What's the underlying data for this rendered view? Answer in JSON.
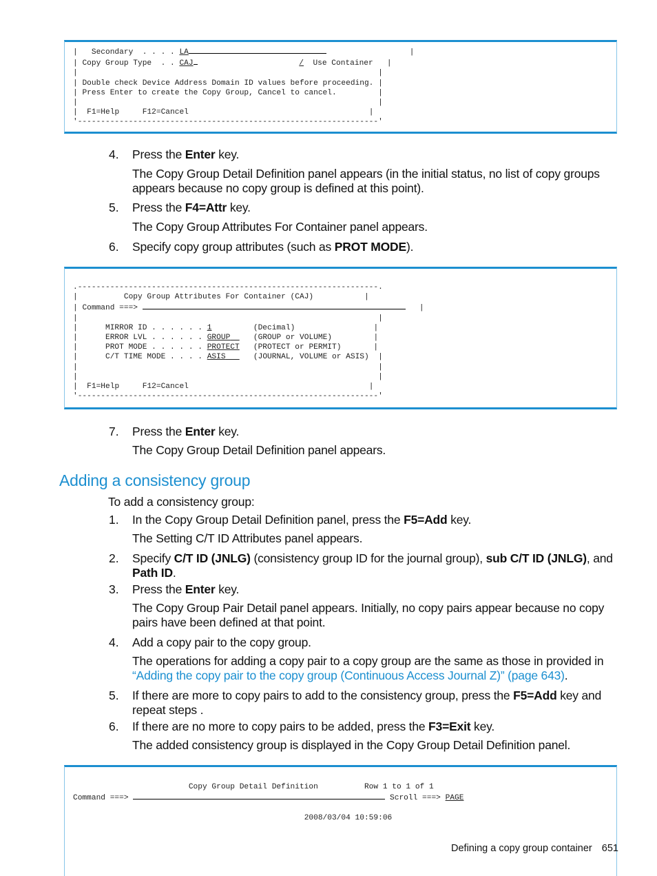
{
  "panel1": {
    "secondary_label": "Secondary  . . . .",
    "secondary_value": "LA",
    "type_label": "Copy Group Type  . .",
    "type_value": "CAJ",
    "use_container_mark": "/",
    "use_container_label": "Use Container",
    "message1": "Double check Device Address Domain ID values before proceeding.",
    "message2": "Press Enter to create the Copy Group, Cancel to cancel.",
    "f1": "F1=Help",
    "f12": "F12=Cancel"
  },
  "steps_a": [
    {
      "num": "4.",
      "pre": "Press the ",
      "key": "Enter",
      "post": " key.",
      "desc": "The Copy Group Detail Definition panel appears (in the initial status, no list of copy groups appears because no copy group is defined at this point)."
    },
    {
      "num": "5.",
      "pre": "Press the ",
      "key": "F4=Attr",
      "post": " key.",
      "desc": "The Copy Group Attributes For Container panel appears."
    },
    {
      "num": "6.",
      "pre": "Specify copy group attributes (such as ",
      "key": "PROT MODE",
      "post": ")."
    }
  ],
  "panel2": {
    "title": "Copy Group Attributes For Container (CAJ)",
    "command_label": "Command ===>",
    "fields": [
      {
        "label": "MIRROR ID . . . . . .",
        "value": "1",
        "hint": "(Decimal)"
      },
      {
        "label": "ERROR LVL . . . . . .",
        "value": "GROUP",
        "hint": "(GROUP or VOLUME)"
      },
      {
        "label": "PROT MODE . . . . . .",
        "value": "PROTECT",
        "hint": "(PROTECT or PERMIT)"
      },
      {
        "label": "C/T TIME MODE . . . .",
        "value": "ASIS",
        "hint": "(JOURNAL, VOLUME or ASIS)"
      }
    ],
    "f1": "F1=Help",
    "f12": "F12=Cancel"
  },
  "step7": {
    "num": "7.",
    "pre": "Press the ",
    "key": "Enter",
    "post": " key.",
    "desc": "The Copy Group Detail Definition panel appears."
  },
  "section": {
    "heading": "Adding a consistency group",
    "intro": "To add a consistency group:",
    "steps": [
      {
        "num": "1.",
        "text_pre": "In the Copy Group Detail Definition panel, press the ",
        "key": "F5=Add",
        "text_post": " key.",
        "desc": "The Setting C/T ID Attributes panel appears."
      },
      {
        "num": "2.",
        "text_pre": "Specify ",
        "key": "C/T ID (JNLG)",
        "text_mid": " (consistency group ID for the journal group), ",
        "key2": "sub C/T ID (JNLG)",
        "text_mid2": ", and ",
        "key3": "Path ID",
        "text_post": "."
      },
      {
        "num": "3.",
        "text_pre": "Press the ",
        "key": "Enter",
        "text_post": " key.",
        "desc": "The Copy Group Pair Detail panel appears. Initially, no copy pairs appear because no copy pairs have been defined at that point."
      },
      {
        "num": "4.",
        "text": "Add a copy pair to the copy group.",
        "desc_pre": "The operations for adding a copy pair to a copy group are the same as those in provided in ",
        "link": "“Adding the copy pair to the copy group (Continuous Access Journal Z)” (page 643)",
        "desc_post": "."
      },
      {
        "num": "5.",
        "text_pre": "If there are more to copy pairs to add to the consistency group, press the ",
        "key": "F5=Add",
        "text_post": " key and repeat steps ."
      },
      {
        "num": "6.",
        "text_pre": "If there are no more to copy pairs to be added, press the ",
        "key": "F3=Exit",
        "text_post": " key.",
        "desc": "The added consistency group is displayed in the Copy Group Detail Definition panel."
      }
    ]
  },
  "panel3": {
    "title": "Copy Group Detail Definition",
    "row_info": "Row 1 to 1 of 1",
    "command_label": "Command ===>",
    "scroll_label": "Scroll ===>",
    "scroll_value": "PAGE",
    "timestamp": "2008/03/04 10:59:06"
  },
  "footer": {
    "section": "Defining a copy group container",
    "page": "651"
  }
}
